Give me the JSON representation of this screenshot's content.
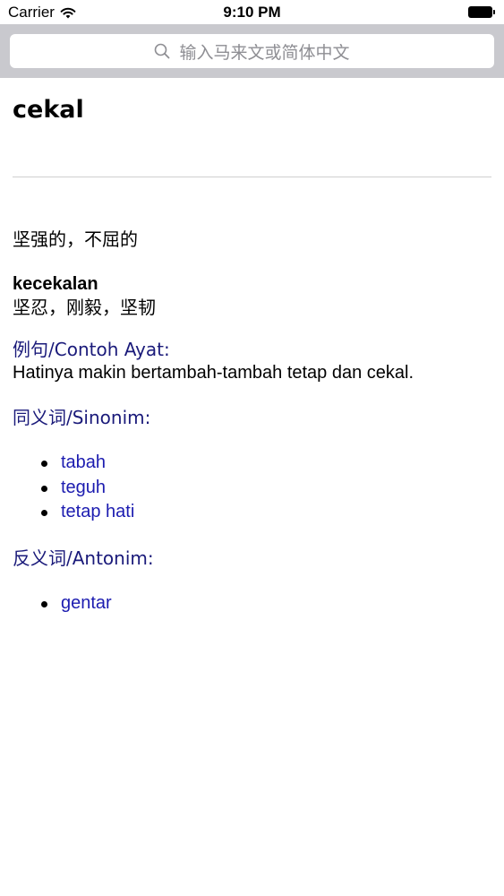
{
  "status_bar": {
    "carrier": "Carrier",
    "time": "9:10 PM"
  },
  "search": {
    "placeholder": "输入马来文或简体中文"
  },
  "entry": {
    "headword": "cekal",
    "meaning": "坚强的，不屈的",
    "derived_word": "kecekalan",
    "derived_meaning": "坚忍，刚毅，坚韧",
    "example_label": "例句/Contoh Ayat:",
    "example_text": "Hatinya makin bertambah-tambah tetap dan cekal.",
    "synonym_label": "同义词/Sinonim:",
    "synonyms": [
      "tabah",
      "teguh",
      "tetap hati"
    ],
    "antonym_label": "反义词/Antonim:",
    "antonyms": [
      "gentar"
    ]
  },
  "colors": {
    "search_bar_bg": "#c9c9ce",
    "label_color": "#1a1a7a",
    "link_color": "#1c1cb0"
  }
}
